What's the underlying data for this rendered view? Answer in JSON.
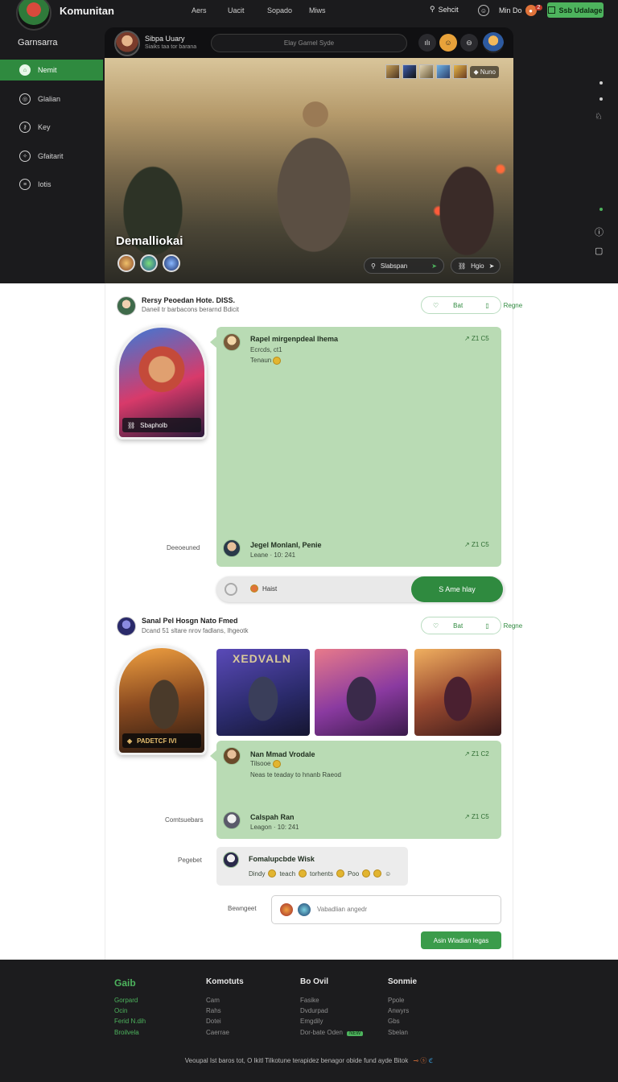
{
  "colors": {
    "accent": "#2f8a3f",
    "panel": "#b9dbb4",
    "dark": "#1b1b1d"
  },
  "topnav": {
    "brand": "Komunitan",
    "links": [
      "Aers",
      "Uacit",
      "Sopado",
      "Miws"
    ],
    "right_search": "Sehcit",
    "user_label": "Min Do",
    "notif_count": "2",
    "cta_label": "Ssb Udalage"
  },
  "sidebar": {
    "title": "Garnsarra",
    "items": [
      {
        "label": "Nemit",
        "icon": "home-icon"
      },
      {
        "label": "Glalian",
        "icon": "globe-icon"
      },
      {
        "label": "Key",
        "icon": "key-icon"
      },
      {
        "label": "Gfaitarit",
        "icon": "compass-icon"
      },
      {
        "label": "Iotis",
        "icon": "list-icon"
      }
    ]
  },
  "hero": {
    "username": "Sibpa Uuary",
    "user_sub": "Siaiks taa tor barana",
    "search_placeholder": "Elay Garnel Syde",
    "thumbs_label": "Nuno",
    "title": "Demalliokai",
    "pill_left": "Slabspan",
    "pill_right": "Hgio"
  },
  "post1": {
    "title": "Rersy Peoedan Hote. DISS.",
    "subtitle": "Daneil tr barbacons berarnd Bdicit",
    "like_label": "Bat",
    "share_label": "Regne",
    "card_badge": "Sbapholb",
    "msg1": {
      "name": "Rapel mirgenpdeal Ihema",
      "line1": "Ecrcds, ct1",
      "line2": "Tenaun",
      "count": "Z1 C5"
    },
    "msg2": {
      "name": "Jegel Monlanl, Penie",
      "line1": "Leane · 10: 241",
      "count": "Z1 C5",
      "side_label": "Deeoeuned"
    },
    "reply_hint": "Haist",
    "reply_button": "S Ame hlay"
  },
  "post2": {
    "title": "Sanal Pel Hosgn Nato Fmed",
    "subtitle": "Dcand 51 sltare nrov fadlans, Ihgeotk",
    "like_label": "Bat",
    "share_label": "Regne",
    "card_badge": "PADETCF IVI",
    "gallery_caption": "XEDVALN",
    "msg1": {
      "name": "Nan Mmad Vrodale",
      "line1": "Tilsooe",
      "line2": "Neas te teaday to hnanb Raeod",
      "count": "Z1 C2"
    },
    "msg2": {
      "name": "Calspah Ran",
      "line1": "Leagon · 10: 241",
      "count": "Z1 C5",
      "side_label": "Comtsuebars"
    },
    "comment": {
      "side_label": "Pegebet",
      "name": "Fomalupcbde Wisk",
      "text_a": "Dindy",
      "text_b": "teach",
      "text_c": "torhents",
      "text_d": "Poo"
    },
    "input": {
      "side_label": "Bewngeet",
      "placeholder": "Vabadlian angedr"
    },
    "post_button": "Asin Wiadian Iegas"
  },
  "footer": {
    "columns": [
      {
        "head": "Gaib",
        "links": [
          "Gorpard",
          "Ocin",
          "Ferid N.dih",
          "Broilvela"
        ]
      },
      {
        "head": "Komotuts",
        "links": [
          "Cam",
          "Rahs",
          "Dotei",
          "Caerrae"
        ]
      },
      {
        "head": "Bo Ovil",
        "links": [
          "Fasike",
          "Dvdurpad",
          "Emgdily",
          "Dor-bate Oden"
        ]
      },
      {
        "head": "Sonmie",
        "links": [
          "Ppole",
          "Anwyrs",
          "Gbs",
          "Sbelan"
        ]
      }
    ],
    "new_badge": "NEW",
    "bottom_text": "Veoupal Ist baros tot, O lkitl Tilkotune terapidez benagor obide fund ayde Bitok"
  }
}
